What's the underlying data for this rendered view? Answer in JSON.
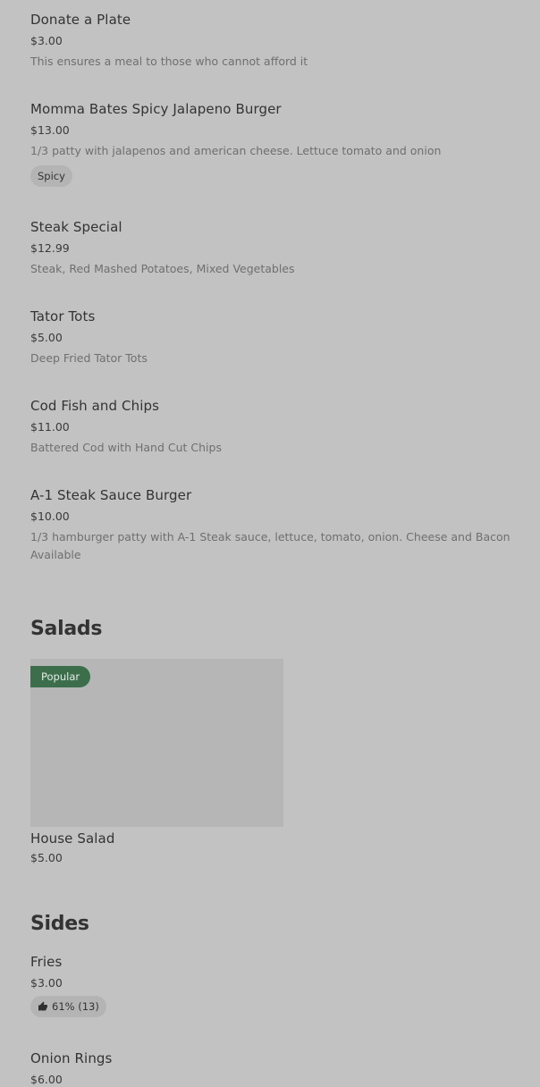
{
  "items": {
    "donate": {
      "name": "Donate a Plate",
      "price": "$3.00",
      "description": "This ensures a meal to those who cannot afford it"
    },
    "jalapeno_burger": {
      "name": "Momma Bates Spicy Jalapeno Burger",
      "price": "$13.00",
      "description": "1/3 patty with jalapenos and american cheese. Lettuce tomato and onion",
      "tag": "Spicy"
    },
    "steak_special": {
      "name": "Steak Special",
      "price": "$12.99",
      "description": "Steak, Red Mashed Potatoes, Mixed Vegetables"
    },
    "tator_tots": {
      "name": "Tator Tots",
      "price": "$5.00",
      "description": "Deep Fried Tator Tots"
    },
    "cod_fish": {
      "name": "Cod Fish and Chips",
      "price": "$11.00",
      "description": "Battered Cod with Hand Cut Chips"
    },
    "a1_burger": {
      "name": "A-1 Steak Sauce Burger",
      "price": "$10.00",
      "description": "1/3 hamburger patty with A-1 Steak sauce, lettuce, tomato, onion. Cheese and Bacon Available"
    }
  },
  "salads": {
    "title": "Salads",
    "house_salad": {
      "badge": "Popular",
      "name": "House Salad",
      "price": "$5.00"
    }
  },
  "sides": {
    "title": "Sides",
    "fries": {
      "name": "Fries",
      "price": "$3.00",
      "rating": "61% (13)"
    },
    "onion_rings": {
      "name": "Onion Rings",
      "price": "$6.00"
    }
  },
  "colors": {
    "background": "#c2c2c2",
    "popular_badge": "#3c6e4c",
    "chip": "#b4b4b4"
  },
  "icons": {
    "rating": "thumbs-up-icon"
  }
}
